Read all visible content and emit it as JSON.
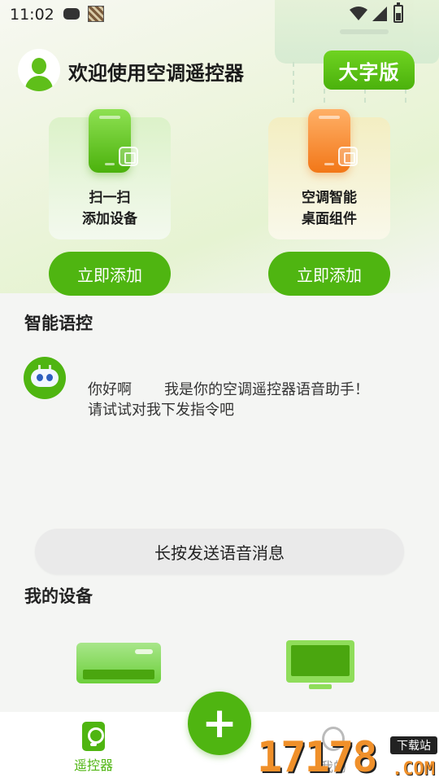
{
  "status_bar": {
    "time": "11:02"
  },
  "header": {
    "title": "欢迎使用空调遥控器",
    "large_mode_label": "大字版"
  },
  "features": [
    {
      "line1": "扫一扫",
      "line2": "添加设备",
      "button": "立即添加"
    },
    {
      "line1": "空调智能",
      "line2": "桌面组件",
      "button": "立即添加"
    }
  ],
  "voice": {
    "section_title": "智能语控",
    "greeting": "你好啊       我是你的空调遥控器语音助手！\n请试试对我下发指令吧",
    "hold_button": "长按发送语音消息"
  },
  "devices": {
    "section_title": "我的设备"
  },
  "nav": {
    "remote_label": "遥控器",
    "mine_label": "我的",
    "add_symbol": "+"
  },
  "watermark": {
    "number": "17178",
    "tag": "下载站",
    "suffix": ".COM"
  },
  "colors": {
    "accent": "#4fb511",
    "orange": "#f27718"
  }
}
